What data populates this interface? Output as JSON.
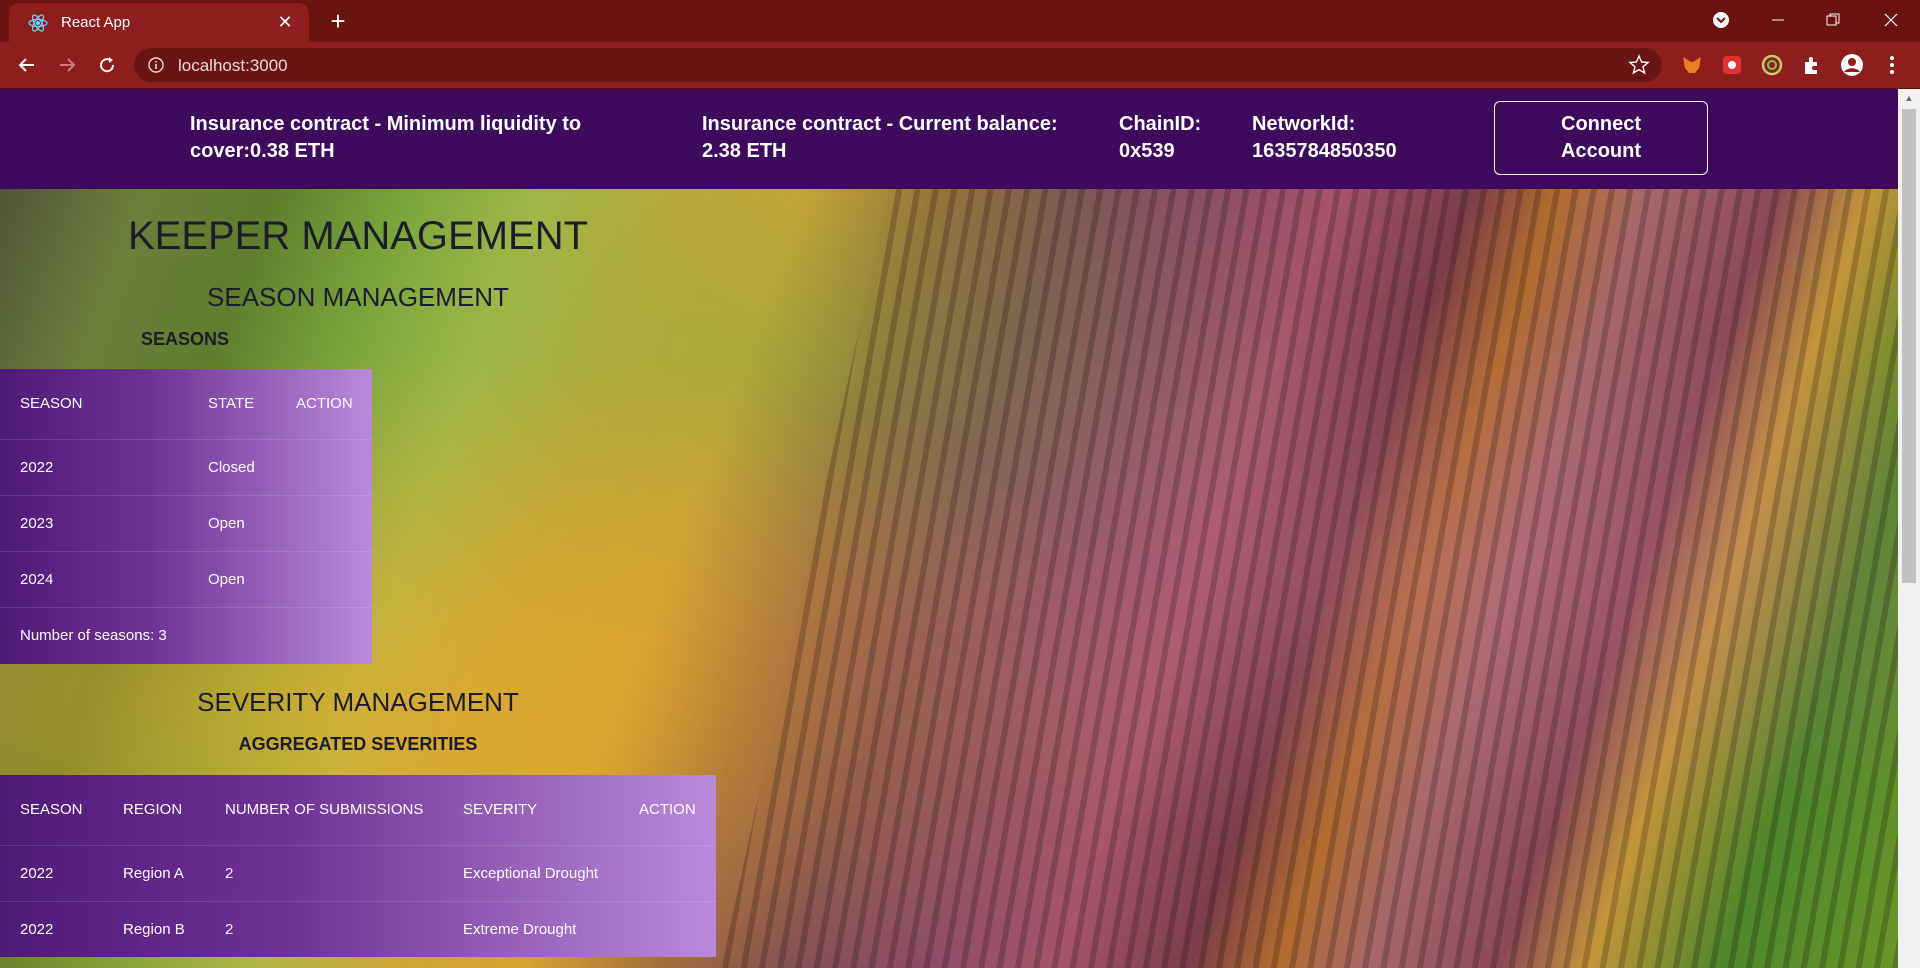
{
  "browser": {
    "tab_title": "React App",
    "url": "localhost:3000"
  },
  "header": {
    "min_liquidity_line1": "Insurance contract - Minimum liquidity to",
    "min_liquidity_line2": "cover:0.38 ETH",
    "balance_line1": "Insurance contract - Current balance:",
    "balance_line2": "2.38 ETH",
    "chain_label": "ChainID:",
    "chain_value": "0x539",
    "network_label": "NetworkId:",
    "network_value": "1635784850350",
    "connect_line1": "Connect",
    "connect_line2": "Account"
  },
  "main": {
    "title": "KEEPER MANAGEMENT",
    "season_section": "SEASON MANAGEMENT",
    "seasons_heading": "SEASONS",
    "seasons_table": {
      "headers": [
        "SEASON",
        "STATE",
        "ACTION"
      ],
      "rows": [
        {
          "season": "2022",
          "state": "Closed"
        },
        {
          "season": "2023",
          "state": "Open"
        },
        {
          "season": "2024",
          "state": "Open"
        }
      ],
      "footer": "Number of seasons: 3"
    },
    "severity_section": "SEVERITY MANAGEMENT",
    "aggregated_heading": "AGGREGATED SEVERITIES",
    "severity_table": {
      "headers": [
        "SEASON",
        "REGION",
        "NUMBER OF SUBMISSIONS",
        "SEVERITY",
        "ACTION"
      ],
      "rows": [
        {
          "season": "2022",
          "region": "Region A",
          "submissions": "2",
          "severity": "Exceptional Drought"
        },
        {
          "season": "2022",
          "region": "Region B",
          "submissions": "2",
          "severity": "Extreme Drought"
        }
      ]
    }
  },
  "colors": {
    "tabstrip": "#6b1212",
    "toolbar": "#8e1d1d",
    "topbar": "#3d0a5e",
    "table_start": "#4e1a78",
    "table_end": "#b98adb"
  },
  "icons": [
    "react-favicon",
    "close-icon",
    "plus-icon",
    "chrome-profile-icon",
    "minimize-icon",
    "maximize-icon",
    "window-close-icon",
    "back-icon",
    "forward-icon",
    "reload-icon",
    "info-icon",
    "star-icon",
    "metamask-icon",
    "extension-icon",
    "puzzle-icon",
    "account-icon",
    "menu-icon"
  ]
}
